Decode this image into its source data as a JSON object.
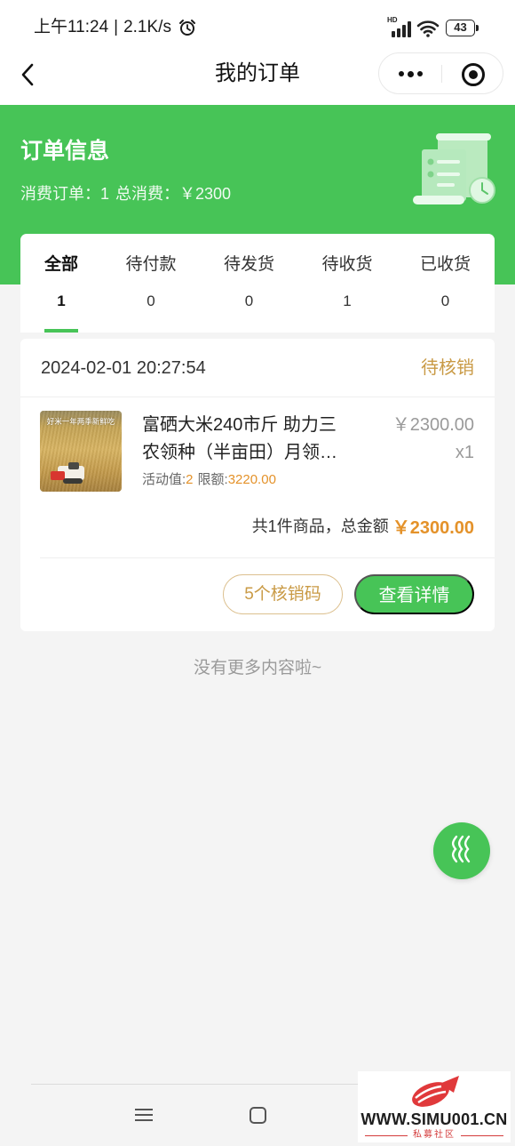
{
  "status_bar": {
    "time": "上午11:24",
    "separator": "|",
    "network_speed": "2.1K/s",
    "hd_label": "HD",
    "battery_level": "43"
  },
  "nav": {
    "title": "我的订单"
  },
  "summary": {
    "title": "订单信息",
    "orders_label": "消费订单：",
    "orders_count": "1",
    "total_label": "总消费：",
    "total_amount": "￥2300"
  },
  "tabs": [
    {
      "label": "全部",
      "count": "1",
      "active": true
    },
    {
      "label": "待付款",
      "count": "0",
      "active": false
    },
    {
      "label": "待发货",
      "count": "0",
      "active": false
    },
    {
      "label": "待收货",
      "count": "1",
      "active": false
    },
    {
      "label": "已收货",
      "count": "0",
      "active": false
    }
  ],
  "orders": [
    {
      "datetime": "2024-02-01 20:27:54",
      "status": "待核销",
      "product": {
        "image_caption": "好米一年两季新鲜吃",
        "title": "富硒大米240市斤 助力三农领种（半亩田）月领…",
        "price": "￥2300.00",
        "quantity": "x1",
        "activity_label": "活动值:",
        "activity_value": "2",
        "limit_label": "限额:",
        "limit_value": "3220.00"
      },
      "total_label": "共1件商品，总金额",
      "total_amount": "￥2300.00",
      "buttons": {
        "codes": "5个核销码",
        "details": "查看详情"
      }
    }
  ],
  "list_end_text": "没有更多内容啦~",
  "watermark": {
    "url": "WWW.SIMU001.CN",
    "name": "私募社区"
  },
  "colors": {
    "primary_green": "#47c457",
    "accent_gold": "#c99a45",
    "accent_orange": "#e4922a",
    "background": "#f4f4f4"
  },
  "icons": {
    "alarm": "alarm-icon",
    "signal": "signal-icon",
    "wifi": "wifi-icon",
    "battery": "battery-icon",
    "back": "back-arrow-icon",
    "more": "more-dots-icon",
    "close": "target-close-icon",
    "header_illustration": "receipt-clock-icon",
    "floating": "wave-icon",
    "system_menu": "menu-icon",
    "system_home": "home-square-icon",
    "watermark_logo": "logo-icon"
  }
}
